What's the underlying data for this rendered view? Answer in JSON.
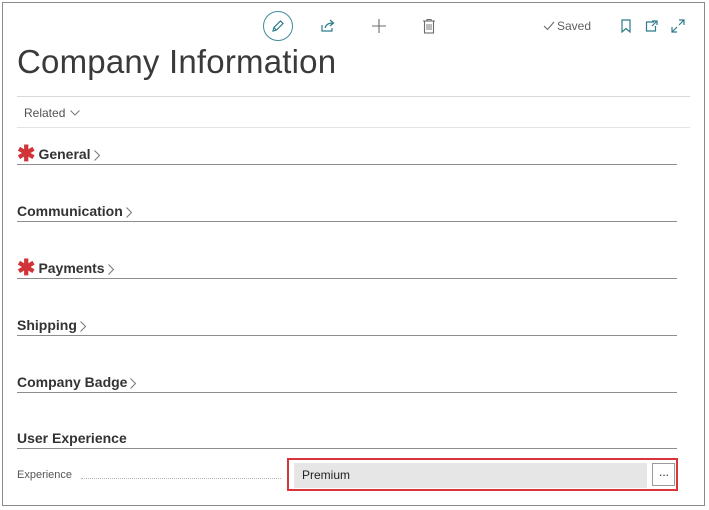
{
  "toolbar": {
    "edit_icon": "pencil-icon",
    "share_icon": "share-icon",
    "new_icon": "plus-icon",
    "delete_icon": "trash-icon",
    "saved_label": "Saved",
    "bookmark_icon": "bookmark-icon",
    "popout_icon": "open-in-new-window-icon",
    "expand_icon": "expand-icon"
  },
  "page": {
    "title": "Company Information",
    "related_label": "Related"
  },
  "sections": [
    {
      "label": "General",
      "required": true
    },
    {
      "label": "Communication",
      "required": false
    },
    {
      "label": "Payments",
      "required": true
    },
    {
      "label": "Shipping",
      "required": false
    },
    {
      "label": "Company Badge",
      "required": false
    },
    {
      "label": "User Experience",
      "required": false
    }
  ],
  "user_experience": {
    "field_label": "Experience",
    "field_value": "Premium",
    "assist_label": "···"
  },
  "colors": {
    "accent": "#2b7c8a",
    "required": "#d13438",
    "highlight": "#d9343a"
  }
}
